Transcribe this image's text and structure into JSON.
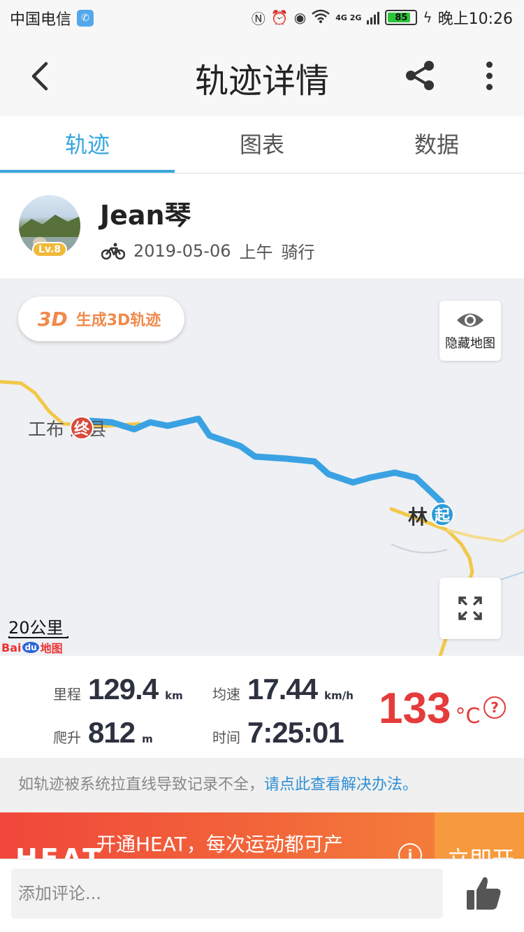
{
  "status_bar": {
    "carrier": "中国电信",
    "time": "晚上10:26",
    "battery": "85",
    "battery_level": 0.85,
    "network": "4G 2G"
  },
  "header": {
    "title": "轨迹详情"
  },
  "tabs": [
    {
      "label": "轨迹",
      "active": true
    },
    {
      "label": "图表",
      "active": false
    },
    {
      "label": "数据",
      "active": false
    }
  ],
  "profile": {
    "username": "Jean琴",
    "level": "Lv.8",
    "date": "2019-05-06",
    "period": "上午",
    "activity": "骑行"
  },
  "map": {
    "btn_3d_icon": "3D",
    "btn_3d_label": "生成3D轨迹",
    "hide_label": "隐藏地图",
    "end_city": "工布 达县",
    "end_marker": "终",
    "start_city": "林 市",
    "start_marker": "起",
    "scale": "20公里",
    "logo_bai": "Bai",
    "logo_du": "du",
    "logo_map": "地图",
    "route_color": "#3aa2e3",
    "road_color": "#f1c84a"
  },
  "stats": {
    "distance_label": "里程",
    "distance_value": "129.4",
    "distance_unit": "km",
    "speed_label": "均速",
    "speed_value": "17.44",
    "speed_unit": "km/h",
    "climb_label": "爬升",
    "climb_value": "812",
    "climb_unit": "m",
    "time_label": "时间",
    "time_value": "7:25:01",
    "temperature": "133",
    "temperature_unit": "°C",
    "help": "?"
  },
  "notice": {
    "text": "如轨迹被系统拉直线导致记录不全，",
    "link": "请点此查看解决办法。"
  },
  "promo": {
    "logo": "HEAT",
    "text": "开通HEAT，每次运动都可产",
    "info": "i",
    "cta": "立即开"
  },
  "comment": {
    "placeholder": "添加评论..."
  }
}
